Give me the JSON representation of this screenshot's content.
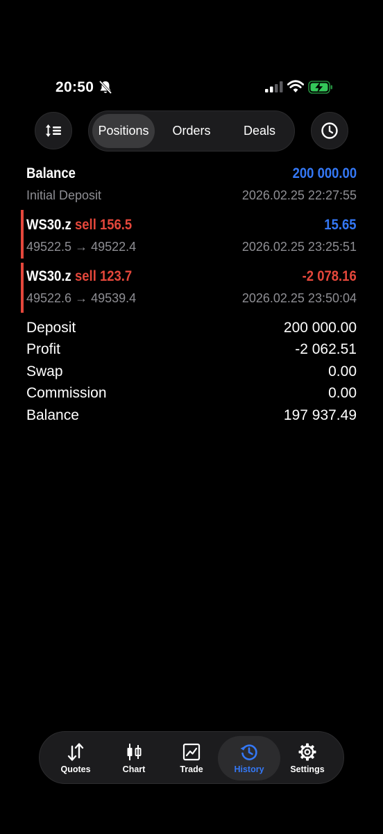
{
  "status": {
    "time": "20:50"
  },
  "toolbar": {
    "segments": [
      {
        "label": "Positions",
        "active": true
      },
      {
        "label": "Orders",
        "active": false
      },
      {
        "label": "Deals",
        "active": false
      }
    ]
  },
  "balance_entry": {
    "title": "Balance",
    "amount": "200 000.00",
    "subtitle": "Initial Deposit",
    "datetime": "2026.02.25 22:27:55"
  },
  "deals": [
    {
      "symbol": "WS30.z",
      "action": "sell 156.5",
      "profit": "15.65",
      "prices": "49522.5 → 49522.4",
      "datetime": "2026.02.25 23:25:51"
    },
    {
      "symbol": "WS30.z",
      "action": "sell 123.7",
      "profit": "-2 078.16",
      "prices": "49522.6 → 49539.4",
      "datetime": "2026.02.25 23:50:04"
    }
  ],
  "summary": [
    {
      "label": "Deposit",
      "value": "200 000.00"
    },
    {
      "label": "Profit",
      "value": "-2 062.51"
    },
    {
      "label": "Swap",
      "value": "0.00"
    },
    {
      "label": "Commission",
      "value": "0.00"
    },
    {
      "label": "Balance",
      "value": "197 937.49"
    }
  ],
  "tabbar": {
    "tabs": [
      {
        "label": "Quotes",
        "icon": "quotes-arrows-icon"
      },
      {
        "label": "Chart",
        "icon": "candlestick-icon"
      },
      {
        "label": "Trade",
        "icon": "trend-chart-icon"
      },
      {
        "label": "History",
        "icon": "history-icon",
        "active": true
      },
      {
        "label": "Settings",
        "icon": "gear-icon"
      }
    ]
  },
  "colors": {
    "accent": "#3478f6",
    "loss": "#e4473b",
    "muted": "#8e8e93"
  }
}
